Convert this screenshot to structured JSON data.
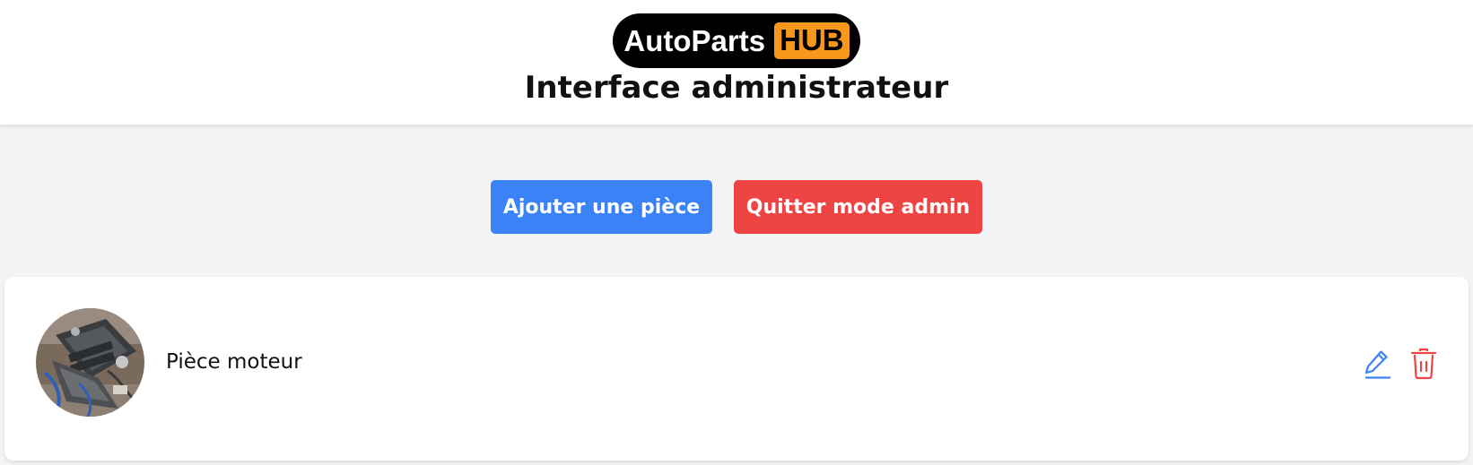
{
  "header": {
    "logo": {
      "text": "AutoParts",
      "badge": "HUB"
    },
    "title": "Interface administrateur"
  },
  "actions": {
    "add_label": "Ajouter une pièce",
    "quit_label": "Quitter mode admin"
  },
  "items": [
    {
      "name": "Pièce moteur",
      "image": "engine-photo",
      "actions": [
        {
          "icon": "pencil-icon",
          "label": "edit"
        },
        {
          "icon": "trash-icon",
          "label": "delete"
        }
      ]
    }
  ],
  "colors": {
    "primary": "#3b82f6",
    "danger": "#ef4444",
    "logo_badge": "#f7971c",
    "background": "#f3f4f6"
  }
}
